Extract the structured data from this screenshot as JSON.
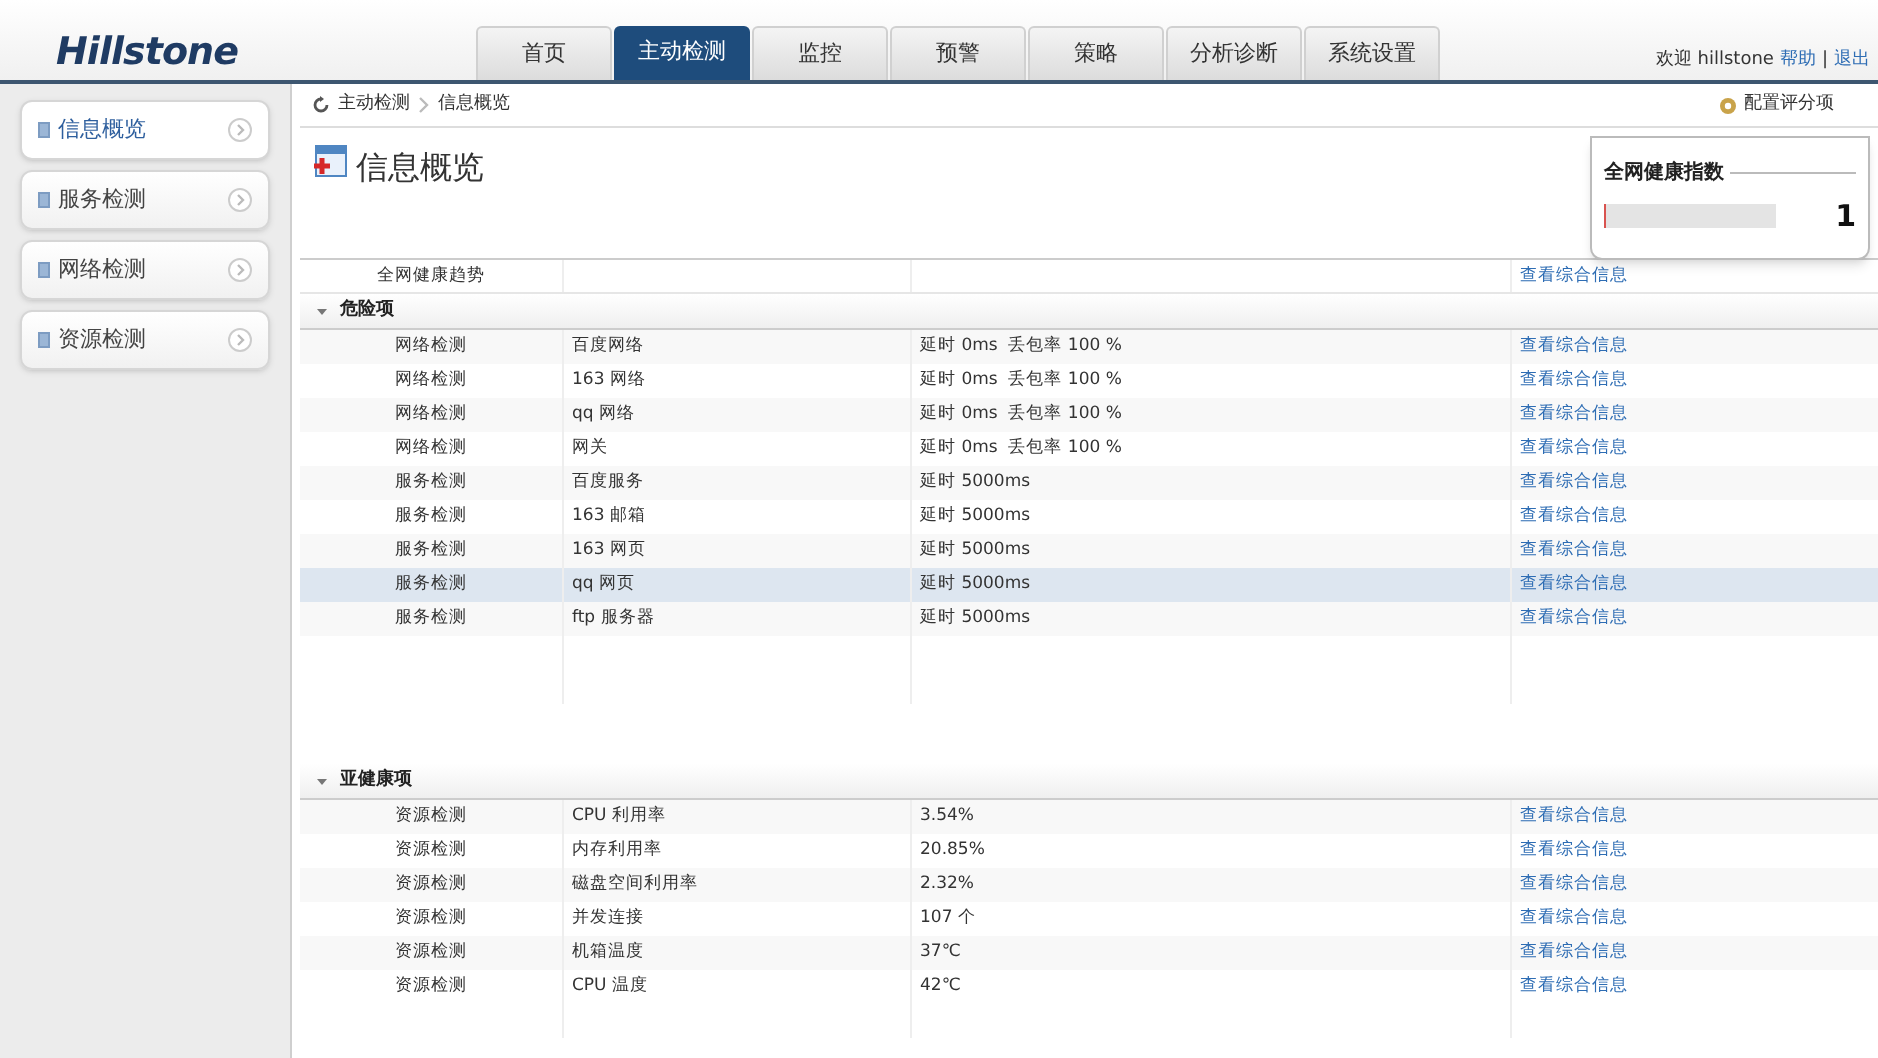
{
  "header": {
    "logo": "Hillstone",
    "tabs": [
      {
        "label": "首页",
        "selected": false
      },
      {
        "label": "主动检测",
        "selected": true
      },
      {
        "label": "监控",
        "selected": false
      },
      {
        "label": "预警",
        "selected": false
      },
      {
        "label": "策略",
        "selected": false
      },
      {
        "label": "分析诊断",
        "selected": false
      },
      {
        "label": "系统设置",
        "selected": false
      }
    ],
    "welcome": "欢迎 hillstone",
    "help": "帮助",
    "separator": "|",
    "logout": "退出"
  },
  "sidebar": {
    "items": [
      {
        "label": "信息概览",
        "selected": true
      },
      {
        "label": "服务检测",
        "selected": false
      },
      {
        "label": "网络检测",
        "selected": false
      },
      {
        "label": "资源检测",
        "selected": false
      }
    ]
  },
  "breadcrumb": [
    "主动检测",
    "信息概览"
  ],
  "config_link": "配置评分项",
  "page_title": "信息概览",
  "health_card": {
    "title": "全网健康指数",
    "level": 0.01,
    "value": "1"
  },
  "table": {
    "trend_row": {
      "label": "全网健康趋势",
      "link": "查看综合信息"
    },
    "groups": [
      {
        "title": "危险项",
        "expanded": true,
        "rows": [
          {
            "cells": [
              "网络检测",
              "百度网络",
              "延时 0ms  丢包率 100 %"
            ],
            "link": "查看综合信息",
            "selected": false
          },
          {
            "cells": [
              "网络检测",
              "163 网络",
              "延时 0ms  丢包率 100 %"
            ],
            "link": "查看综合信息",
            "selected": false
          },
          {
            "cells": [
              "网络检测",
              "qq 网络",
              "延时 0ms  丢包率 100 %"
            ],
            "link": "查看综合信息",
            "selected": false
          },
          {
            "cells": [
              "网络检测",
              "网关",
              "延时 0ms  丢包率 100 %"
            ],
            "link": "查看综合信息",
            "selected": false
          },
          {
            "cells": [
              "服务检测",
              "百度服务",
              "延时 5000ms"
            ],
            "link": "查看综合信息",
            "selected": false
          },
          {
            "cells": [
              "服务检测",
              "163 邮箱",
              "延时 5000ms"
            ],
            "link": "查看综合信息",
            "selected": false
          },
          {
            "cells": [
              "服务检测",
              "163 网页",
              "延时 5000ms"
            ],
            "link": "查看综合信息",
            "selected": false
          },
          {
            "cells": [
              "服务检测",
              "qq 网页",
              "延时 5000ms"
            ],
            "link": "查看综合信息",
            "selected": true
          },
          {
            "cells": [
              "服务检测",
              "ftp 服务器",
              "延时 5000ms"
            ],
            "link": "查看综合信息",
            "selected": false
          }
        ]
      },
      {
        "title": "亚健康项",
        "expanded": true,
        "rows": [
          {
            "cells": [
              "资源检测",
              "CPU 利用率",
              "3.54%"
            ],
            "link": "查看综合信息",
            "selected": false
          },
          {
            "cells": [
              "资源检测",
              "内存利用率",
              "20.85%"
            ],
            "link": "查看综合信息",
            "selected": false
          },
          {
            "cells": [
              "资源检测",
              "磁盘空间利用率",
              "2.32%"
            ],
            "link": "查看综合信息",
            "selected": false
          },
          {
            "cells": [
              "资源检测",
              "并发连接",
              "107 个"
            ],
            "link": "查看综合信息",
            "selected": false
          },
          {
            "cells": [
              "资源检测",
              "机箱温度",
              "37℃"
            ],
            "link": "查看综合信息",
            "selected": false
          },
          {
            "cells": [
              "资源检测",
              "CPU 温度",
              "42℃"
            ],
            "link": "查看综合信息",
            "selected": false
          }
        ]
      }
    ]
  }
}
